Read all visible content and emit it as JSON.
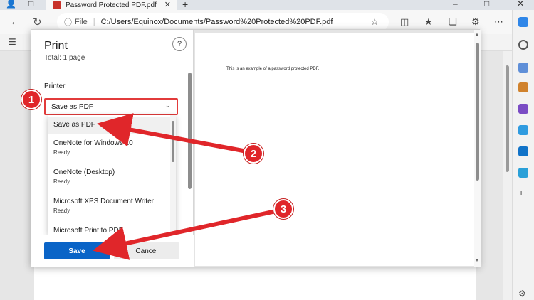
{
  "browser": {
    "tab_title": "Password Protected PDF.pdf",
    "address_prefix": "File",
    "address_url": "C:/Users/Equinox/Documents/Password%20Protected%20PDF.pdf"
  },
  "dialog": {
    "title": "Print",
    "total": "Total: 1 page",
    "help_label": "?",
    "printer_label": "Printer",
    "selected_printer": "Save as PDF",
    "printers": [
      {
        "name": "Save as PDF",
        "status": ""
      },
      {
        "name": "OneNote for Windows 10",
        "status": "Ready"
      },
      {
        "name": "OneNote (Desktop)",
        "status": "Ready"
      },
      {
        "name": "Microsoft XPS Document Writer",
        "status": "Ready"
      },
      {
        "name": "Microsoft Print to PDF",
        "status": ""
      }
    ],
    "save_label": "Save",
    "cancel_label": "Cancel",
    "preview_text": "This is an example of a password protected PDF."
  },
  "annotations": {
    "badges": [
      "1",
      "2",
      "3"
    ],
    "color": "#e0262a"
  },
  "colors": {
    "accent": "#0a64c7",
    "highlight_border": "#e23b3b"
  }
}
